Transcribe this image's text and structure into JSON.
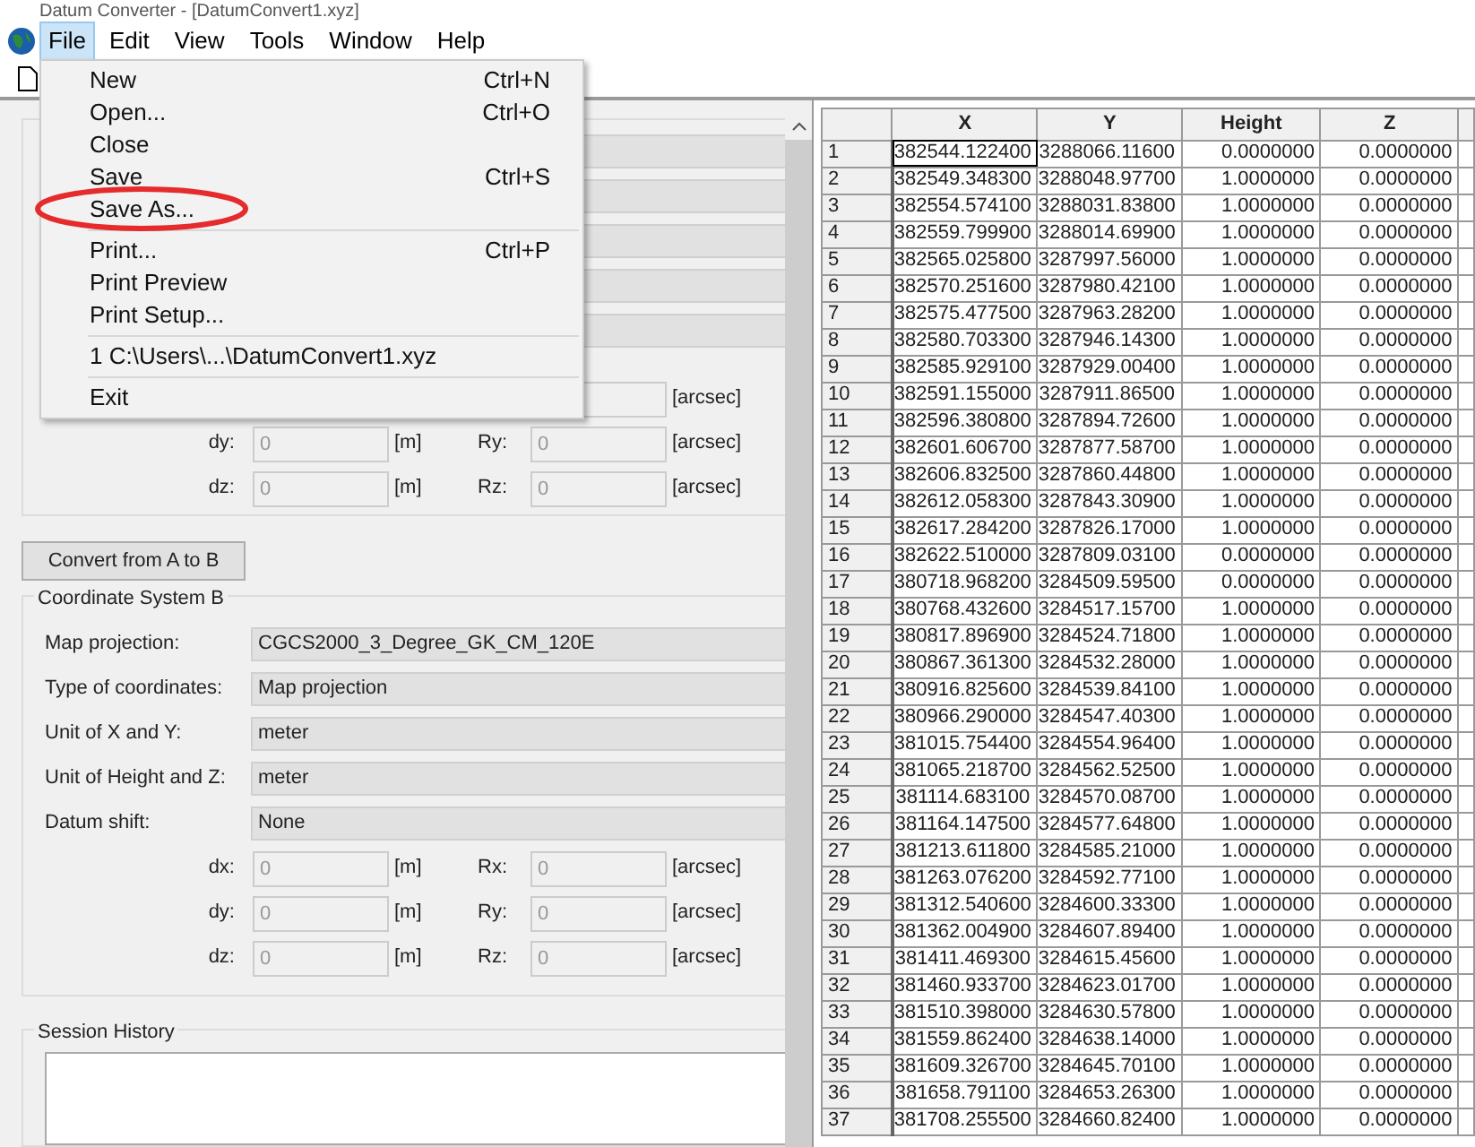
{
  "window": {
    "title": "Datum Converter - [DatumConvert1.xyz]"
  },
  "menu_bar": [
    {
      "label": "File",
      "selected": true
    },
    {
      "label": "Edit",
      "selected": false
    },
    {
      "label": "View",
      "selected": false
    },
    {
      "label": "Tools",
      "selected": false
    },
    {
      "label": "Window",
      "selected": false
    },
    {
      "label": "Help",
      "selected": false
    }
  ],
  "file_menu": [
    {
      "kind": "item",
      "label": "New",
      "shortcut": "Ctrl+N"
    },
    {
      "kind": "item",
      "label": "Open...",
      "shortcut": "Ctrl+O"
    },
    {
      "kind": "item",
      "label": "Close"
    },
    {
      "kind": "item",
      "label": "Save",
      "shortcut": "Ctrl+S"
    },
    {
      "kind": "item",
      "label": "Save As..."
    },
    {
      "kind": "separator"
    },
    {
      "kind": "item",
      "label": "Print...",
      "shortcut": "Ctrl+P"
    },
    {
      "kind": "item",
      "label": "Print Preview"
    },
    {
      "kind": "item",
      "label": "Print Setup..."
    },
    {
      "kind": "separator"
    },
    {
      "kind": "item",
      "label": "1 C:\\Users\\...\\DatumConvert1.xyz"
    },
    {
      "kind": "separator"
    },
    {
      "kind": "item",
      "label": "Exit"
    }
  ],
  "coordinate_system_a": {
    "shift_rows": [
      {
        "unit_r": "[arcsec]"
      },
      {
        "label_d": "dy:",
        "value_d": "0",
        "unit_d": "[m]",
        "label_r": "Ry:",
        "value_r": "0",
        "unit_r": "[arcsec]"
      },
      {
        "label_d": "dz:",
        "value_d": "0",
        "unit_d": "[m]",
        "label_r": "Rz:",
        "value_r": "0",
        "unit_r": "[arcsec]"
      }
    ]
  },
  "convert_button": "Convert from A to B",
  "coordinate_system_b": {
    "title": "Coordinate System B",
    "fields": [
      {
        "label": "Map projection:",
        "value": "CGCS2000_3_Degree_GK_CM_120E"
      },
      {
        "label": "Type of coordinates:",
        "value": "Map projection"
      },
      {
        "label": "Unit of X and Y:",
        "value": "meter"
      },
      {
        "label": "Unit of Height and Z:",
        "value": "meter"
      },
      {
        "label": "Datum shift:",
        "value": "None"
      }
    ],
    "shift_rows": [
      {
        "label_d": "dx:",
        "value_d": "0",
        "unit_d": "[m]",
        "label_r": "Rx:",
        "value_r": "0",
        "unit_r": "[arcsec]"
      },
      {
        "label_d": "dy:",
        "value_d": "0",
        "unit_d": "[m]",
        "label_r": "Ry:",
        "value_r": "0",
        "unit_r": "[arcsec]"
      },
      {
        "label_d": "dz:",
        "value_d": "0",
        "unit_d": "[m]",
        "label_r": "Rz:",
        "value_r": "0",
        "unit_r": "[arcsec]"
      }
    ]
  },
  "session_history": {
    "title": "Session History"
  },
  "table": {
    "columns": [
      "",
      "X",
      "Y",
      "Height",
      "Z"
    ],
    "rows": [
      [
        "1",
        "382544.122400",
        "3288066.11600",
        "0.0000000",
        "0.0000000"
      ],
      [
        "2",
        "382549.348300",
        "3288048.97700",
        "1.0000000",
        "0.0000000"
      ],
      [
        "3",
        "382554.574100",
        "3288031.83800",
        "1.0000000",
        "0.0000000"
      ],
      [
        "4",
        "382559.799900",
        "3288014.69900",
        "1.0000000",
        "0.0000000"
      ],
      [
        "5",
        "382565.025800",
        "3287997.56000",
        "1.0000000",
        "0.0000000"
      ],
      [
        "6",
        "382570.251600",
        "3287980.42100",
        "1.0000000",
        "0.0000000"
      ],
      [
        "7",
        "382575.477500",
        "3287963.28200",
        "1.0000000",
        "0.0000000"
      ],
      [
        "8",
        "382580.703300",
        "3287946.14300",
        "1.0000000",
        "0.0000000"
      ],
      [
        "9",
        "382585.929100",
        "3287929.00400",
        "1.0000000",
        "0.0000000"
      ],
      [
        "10",
        "382591.155000",
        "3287911.86500",
        "1.0000000",
        "0.0000000"
      ],
      [
        "11",
        "382596.380800",
        "3287894.72600",
        "1.0000000",
        "0.0000000"
      ],
      [
        "12",
        "382601.606700",
        "3287877.58700",
        "1.0000000",
        "0.0000000"
      ],
      [
        "13",
        "382606.832500",
        "3287860.44800",
        "1.0000000",
        "0.0000000"
      ],
      [
        "14",
        "382612.058300",
        "3287843.30900",
        "1.0000000",
        "0.0000000"
      ],
      [
        "15",
        "382617.284200",
        "3287826.17000",
        "1.0000000",
        "0.0000000"
      ],
      [
        "16",
        "382622.510000",
        "3287809.03100",
        "0.0000000",
        "0.0000000"
      ],
      [
        "17",
        "380718.968200",
        "3284509.59500",
        "0.0000000",
        "0.0000000"
      ],
      [
        "18",
        "380768.432600",
        "3284517.15700",
        "1.0000000",
        "0.0000000"
      ],
      [
        "19",
        "380817.896900",
        "3284524.71800",
        "1.0000000",
        "0.0000000"
      ],
      [
        "20",
        "380867.361300",
        "3284532.28000",
        "1.0000000",
        "0.0000000"
      ],
      [
        "21",
        "380916.825600",
        "3284539.84100",
        "1.0000000",
        "0.0000000"
      ],
      [
        "22",
        "380966.290000",
        "3284547.40300",
        "1.0000000",
        "0.0000000"
      ],
      [
        "23",
        "381015.754400",
        "3284554.96400",
        "1.0000000",
        "0.0000000"
      ],
      [
        "24",
        "381065.218700",
        "3284562.52500",
        "1.0000000",
        "0.0000000"
      ],
      [
        "25",
        "381114.683100",
        "3284570.08700",
        "1.0000000",
        "0.0000000"
      ],
      [
        "26",
        "381164.147500",
        "3284577.64800",
        "1.0000000",
        "0.0000000"
      ],
      [
        "27",
        "381213.611800",
        "3284585.21000",
        "1.0000000",
        "0.0000000"
      ],
      [
        "28",
        "381263.076200",
        "3284592.77100",
        "1.0000000",
        "0.0000000"
      ],
      [
        "29",
        "381312.540600",
        "3284600.33300",
        "1.0000000",
        "0.0000000"
      ],
      [
        "30",
        "381362.004900",
        "3284607.89400",
        "1.0000000",
        "0.0000000"
      ],
      [
        "31",
        "381411.469300",
        "3284615.45600",
        "1.0000000",
        "0.0000000"
      ],
      [
        "32",
        "381460.933700",
        "3284623.01700",
        "1.0000000",
        "0.0000000"
      ],
      [
        "33",
        "381510.398000",
        "3284630.57800",
        "1.0000000",
        "0.0000000"
      ],
      [
        "34",
        "381559.862400",
        "3284638.14000",
        "1.0000000",
        "0.0000000"
      ],
      [
        "35",
        "381609.326700",
        "3284645.70100",
        "1.0000000",
        "0.0000000"
      ],
      [
        "36",
        "381658.791100",
        "3284653.26300",
        "1.0000000",
        "0.0000000"
      ],
      [
        "37",
        "381708.255500",
        "3284660.82400",
        "1.0000000",
        "0.0000000"
      ]
    ]
  }
}
